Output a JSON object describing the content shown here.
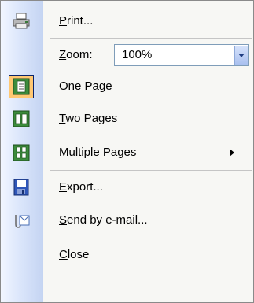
{
  "menu": {
    "print": {
      "pre": "",
      "ul": "P",
      "post": "rint...",
      "icon": "printer-icon"
    },
    "zoom": {
      "pre": "",
      "ul": "Z",
      "post": "oom:",
      "value": "100%"
    },
    "one_page": {
      "pre": "",
      "ul": "O",
      "post": "ne Page",
      "icon": "one-page-icon"
    },
    "two_pages": {
      "pre": "",
      "ul": "T",
      "post": "wo Pages",
      "icon": "two-pages-icon"
    },
    "multiple_pages": {
      "pre": "",
      "ul": "M",
      "post": "ultiple Pages",
      "icon": "multiple-pages-icon"
    },
    "export": {
      "pre": "",
      "ul": "E",
      "post": "xport...",
      "icon": "floppy-disk-icon"
    },
    "send_email": {
      "pre": "",
      "ul": "S",
      "post": "end by e-mail...",
      "icon": "mail-attachment-icon"
    },
    "close": {
      "pre": "",
      "ul": "C",
      "post": "lose"
    }
  },
  "colors": {
    "strip": "#c4d4f2",
    "checked_bg": "#ffc873",
    "checked_border": "#0a246a"
  }
}
